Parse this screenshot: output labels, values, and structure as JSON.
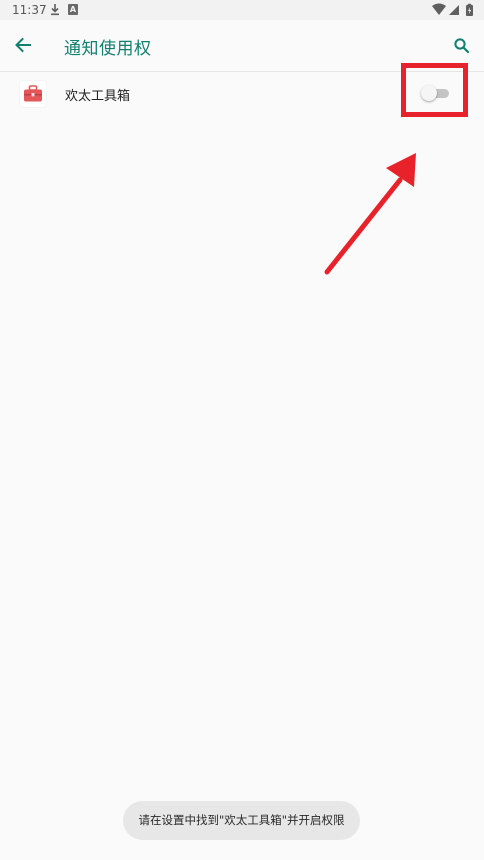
{
  "status_bar": {
    "time": "11:37",
    "download_icon": "download-icon",
    "notification_icon": "a-letter-icon",
    "notification_letter": "A",
    "wifi_icon": "wifi-icon",
    "signal_icon": "signal-icon",
    "battery_icon": "battery-charging-icon"
  },
  "app_bar": {
    "back_icon": "arrow-back-icon",
    "title": "通知使用权",
    "search_icon": "search-icon"
  },
  "colors": {
    "accent": "#12806f",
    "highlight": "#e8222a",
    "toast_bg": "#e7e7e7"
  },
  "apps": [
    {
      "name": "欢太工具箱",
      "icon": "toolbox-icon",
      "enabled": false
    }
  ],
  "toast": {
    "message": "请在设置中找到\"欢太工具箱\"并开启权限"
  }
}
